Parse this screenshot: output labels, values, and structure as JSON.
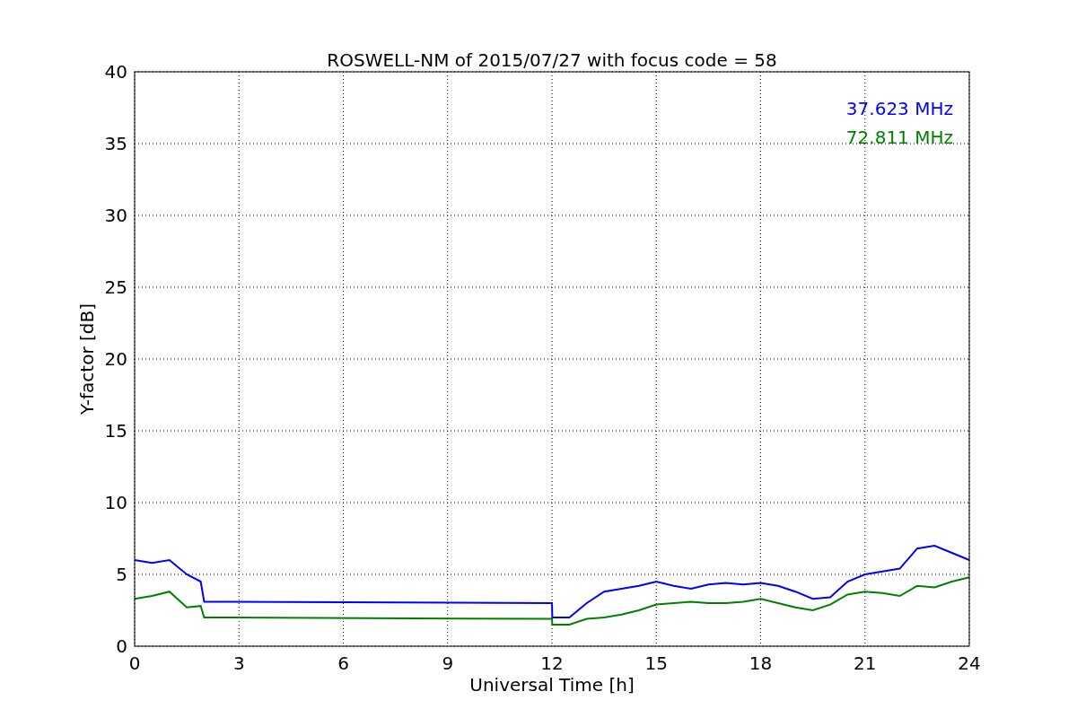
{
  "chart_data": {
    "type": "line",
    "title": "ROSWELL-NM of 2015/07/27 with focus code = 58",
    "xlabel": "Universal Time [h]",
    "ylabel": "Y-factor [dB]",
    "x": [
      0,
      0.5,
      1,
      1.5,
      1.9,
      2,
      12,
      12.01,
      12.5,
      13,
      13.5,
      14,
      14.5,
      15,
      15.5,
      16,
      16.5,
      17,
      17.5,
      18,
      18.5,
      19,
      19.5,
      20,
      20.5,
      21,
      21.5,
      22,
      22.5,
      23,
      23.5,
      24
    ],
    "series": [
      {
        "name": "37.623 MHz",
        "color": "#0000ff",
        "values": [
          6,
          5.8,
          6,
          5,
          4.5,
          3.1,
          3,
          2,
          2,
          3,
          3.8,
          4,
          4.2,
          4.5,
          4.2,
          4,
          4.3,
          4.4,
          4.3,
          4.4,
          4.2,
          3.8,
          3.3,
          3.4,
          4.5,
          5,
          5.2,
          5.4,
          6.8,
          7,
          6.5,
          6
        ]
      },
      {
        "name": "72.811 MHz",
        "color": "#008000",
        "values": [
          3.3,
          3.5,
          3.8,
          2.7,
          2.8,
          2,
          1.9,
          1.5,
          1.5,
          1.9,
          2,
          2.2,
          2.5,
          2.9,
          3,
          3.1,
          3,
          3,
          3.1,
          3.3,
          3,
          2.7,
          2.5,
          2.9,
          3.6,
          3.8,
          3.7,
          3.5,
          4.2,
          4.1,
          4.5,
          4.8
        ]
      }
    ],
    "grid": true,
    "xlim": [
      0,
      24
    ],
    "ylim": [
      0,
      40
    ],
    "xticks": [
      0,
      3,
      6,
      9,
      12,
      15,
      18,
      21,
      24
    ],
    "yticks": [
      0,
      5,
      10,
      15,
      20,
      25,
      30,
      35,
      40
    ]
  }
}
